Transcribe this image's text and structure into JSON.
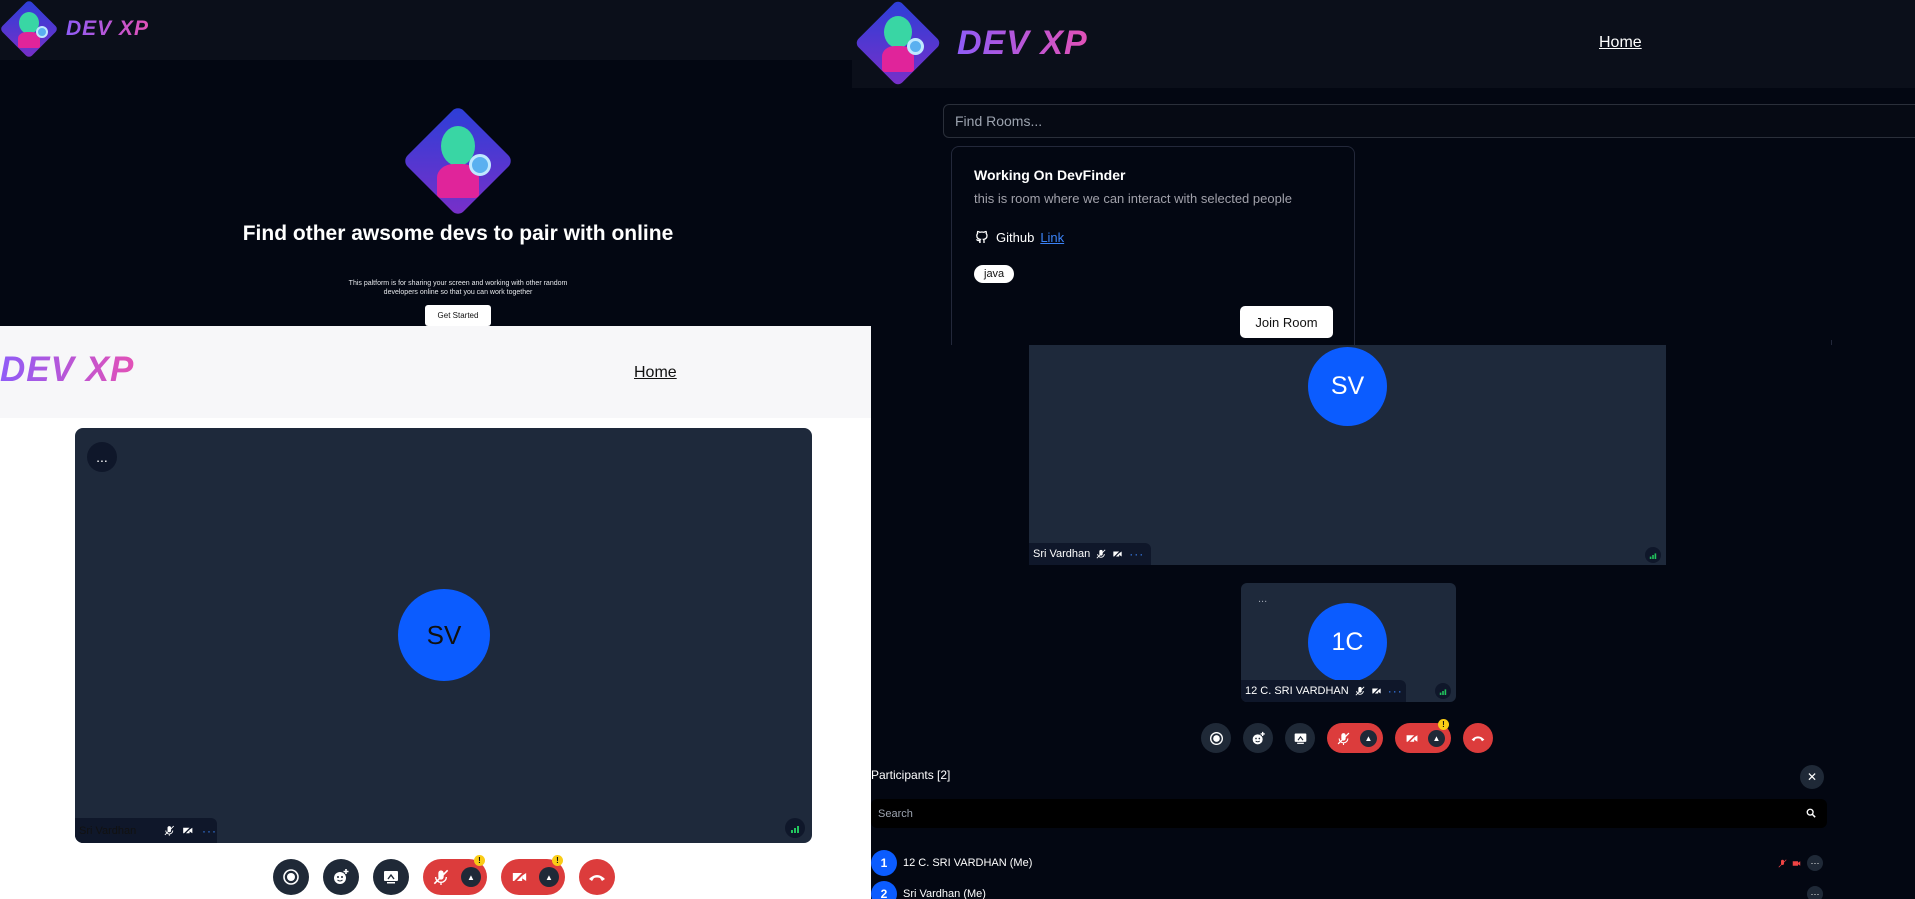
{
  "landing": {
    "brand": "DEV XP",
    "hero_title": "Find other awsome devs to pair with online",
    "hero_subtitle": "This paltform is for sharing your screen and working with other random developers online so that you can work together",
    "cta_label": "Get Started"
  },
  "rooms_page": {
    "brand": "DEV XP",
    "nav_home": "Home",
    "search_placeholder": "Find Rooms...",
    "room": {
      "title": "Working On DevFinder",
      "description": "this is room where we can interact with selected people",
      "github_label": "Github",
      "link_label": "Link",
      "tag": "java",
      "join_label": "Join Room"
    }
  },
  "meeting_light": {
    "brand": "DEV XP",
    "nav_home": "Home",
    "more_label": "...",
    "avatar_initials": "SV",
    "participant_name": "Sri Vardhan",
    "warning_mark": "!"
  },
  "meeting_dark": {
    "tile1": {
      "initials": "SV",
      "name": "Sri Vardhan"
    },
    "tile2": {
      "initials": "1C",
      "name": "12 C. SRI VARDHAN",
      "more_label": "..."
    },
    "warning_mark": "!",
    "participants_title": "Participants [2]",
    "close_label": "✕",
    "search_placeholder": "Search",
    "participants": [
      {
        "index": "1",
        "name": "12 C. SRI VARDHAN (Me)"
      },
      {
        "index": "2",
        "name": "Sri Vardhan (Me)"
      }
    ]
  },
  "colors": {
    "accent_blue": "#0b5cff",
    "danger_red": "#dc3c3c",
    "tile_bg": "#1e293b",
    "brand_gradient_start": "#8f5cf7",
    "brand_gradient_end": "#e251b7"
  }
}
